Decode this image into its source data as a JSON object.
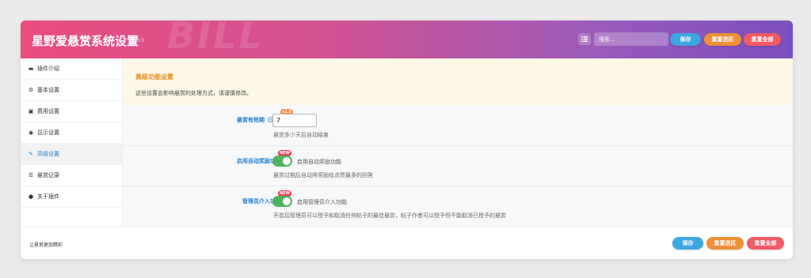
{
  "header": {
    "title": "星野爱悬赏系统设置",
    "version": "v1.0.3",
    "watermark": "BILL",
    "search_placeholder": "搜索...",
    "buttons": {
      "save": "保存",
      "reset_section": "重置选区",
      "reset_all": "重置全部"
    }
  },
  "sidebar": {
    "items": [
      {
        "icon": "book-icon",
        "label": "插件介绍"
      },
      {
        "icon": "gears-icon",
        "label": "基本设置"
      },
      {
        "icon": "money-icon",
        "label": "费用设置"
      },
      {
        "icon": "eye-icon",
        "label": "显示设置"
      },
      {
        "icon": "wrench-icon",
        "label": "高级设置",
        "active": true
      },
      {
        "icon": "database-icon",
        "label": "悬赏记录"
      },
      {
        "icon": "info-icon",
        "label": "关于插件"
      }
    ]
  },
  "notice": {
    "title": "高级功能设置",
    "desc": "这些设置会影响悬赏的处理方式，请谨慎修改。"
  },
  "fields": {
    "expiry": {
      "label": "悬赏有效期（天）",
      "badge": "v1.0",
      "value": "7",
      "help": "悬赏多少天后自动结束"
    },
    "auto_reward": {
      "label": "启用自动奖励功能",
      "badge": "NEW",
      "checked": true,
      "toggle_text": "启用自动奖励功能",
      "help": "悬赏过期后自动将奖励给点赞最多的回答"
    },
    "admin": {
      "label": "管理员介入功能",
      "badge": "NEW",
      "checked": true,
      "toggle_text": "启用管理员介入功能",
      "help": "开启后管理员可以授予和取消任何帖子的最佳悬赏，帖子作者可以授予但不能取消已授予的悬赏"
    }
  },
  "footer": {
    "note": "让悬赏更加精彩",
    "buttons": {
      "save": "保存",
      "reset_section": "重置选区",
      "reset_all": "重置全部"
    }
  },
  "colors": {
    "accent": "#1b7fd1",
    "header_start": "#ea4d7e",
    "header_end": "#7c4fbf",
    "toggle_on": "#4fb35a"
  }
}
